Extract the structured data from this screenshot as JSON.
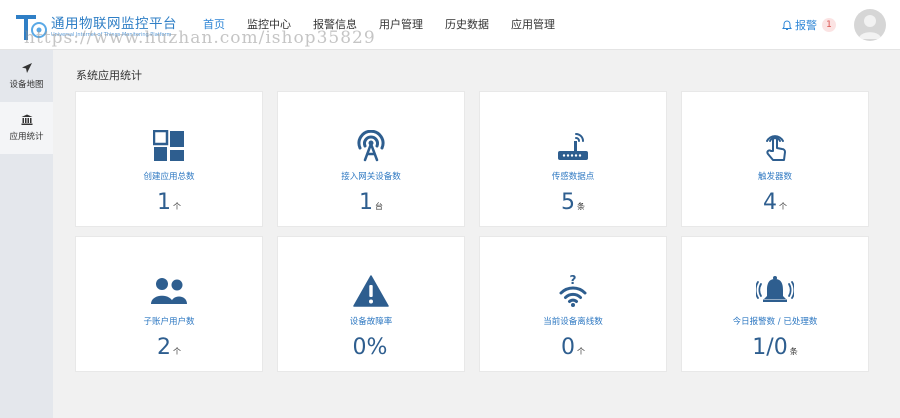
{
  "app": {
    "title": "通用物联网监控平台",
    "subtitle": "Universal Internet of Things Monitoring Platform"
  },
  "nav": {
    "items": [
      {
        "label": "首页",
        "active": true
      },
      {
        "label": "监控中心",
        "active": false
      },
      {
        "label": "报警信息",
        "active": false
      },
      {
        "label": "用户管理",
        "active": false
      },
      {
        "label": "历史数据",
        "active": false
      },
      {
        "label": "应用管理",
        "active": false
      }
    ]
  },
  "header": {
    "alarm_label": "报警",
    "alarm_count": "1"
  },
  "watermark": "https://www.huzhan.com/ishop35829",
  "sidebar": {
    "items": [
      {
        "label": "设备地图",
        "icon": "paper-plane-icon"
      },
      {
        "label": "应用统计",
        "icon": "bank-icon"
      }
    ]
  },
  "main": {
    "title": "系统应用统计",
    "cards": [
      {
        "label": "创建应用总数",
        "value": "1",
        "unit": "个",
        "icon": "dashboard-tiles-icon"
      },
      {
        "label": "接入网关设备数",
        "value": "1",
        "unit": "台",
        "icon": "signal-tower-icon"
      },
      {
        "label": "传感数据点",
        "value": "5",
        "unit": "条",
        "icon": "router-icon"
      },
      {
        "label": "触发器数",
        "value": "4",
        "unit": "个",
        "icon": "touch-hand-icon"
      },
      {
        "label": "子账户用户数",
        "value": "2",
        "unit": "个",
        "icon": "users-icon"
      },
      {
        "label": "设备故障率",
        "value": "0%",
        "unit": "",
        "icon": "warning-triangle-icon"
      },
      {
        "label": "当前设备离线数",
        "value": "0",
        "unit": "个",
        "icon": "wifi-question-icon"
      },
      {
        "label": "今日报警数 / 已处理数",
        "value": "1/0",
        "unit": "条",
        "icon": "alarm-bell-icon"
      }
    ]
  },
  "colors": {
    "accent": "#2e86d6",
    "icon": "#2e5e8f",
    "card_label": "#2e78c2",
    "background": "#f1f1f1",
    "sidebar": "#e4e7ec"
  }
}
